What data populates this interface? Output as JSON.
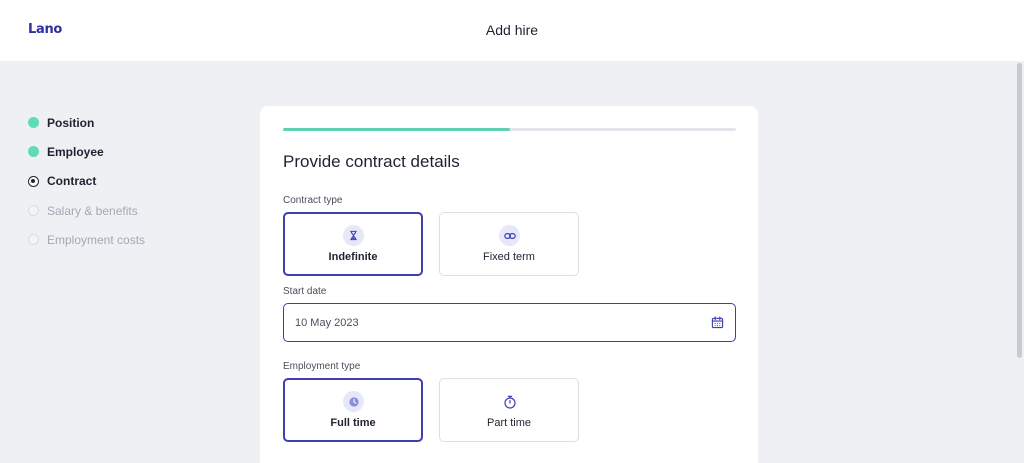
{
  "header": {
    "logo": "Lano",
    "title": "Add hire"
  },
  "steps": [
    {
      "label": "Position",
      "status": "done"
    },
    {
      "label": "Employee",
      "status": "done"
    },
    {
      "label": "Contract",
      "status": "current"
    },
    {
      "label": "Salary & benefits",
      "status": "todo"
    },
    {
      "label": "Employment costs",
      "status": "todo"
    }
  ],
  "form": {
    "progress": 0.5,
    "title": "Provide contract details",
    "contract_type": {
      "label": "Contract type",
      "options": [
        {
          "label": "Indefinite",
          "icon": "hourglass-icon",
          "selected": true
        },
        {
          "label": "Fixed term",
          "icon": "link-icon",
          "selected": false
        }
      ]
    },
    "start_date": {
      "label": "Start date",
      "value": "10 May 2023",
      "icon": "calendar-icon"
    },
    "employment_type": {
      "label": "Employment type",
      "options": [
        {
          "label": "Full time",
          "icon": "clock-icon",
          "selected": true
        },
        {
          "label": "Part time",
          "icon": "stopwatch-icon",
          "selected": false
        }
      ]
    }
  },
  "colors": {
    "accent": "#3d3fb0",
    "brand": "#2d2fa3",
    "done": "#5fdbb6",
    "progress": "#5fd0b0",
    "background": "#eff0f3"
  }
}
